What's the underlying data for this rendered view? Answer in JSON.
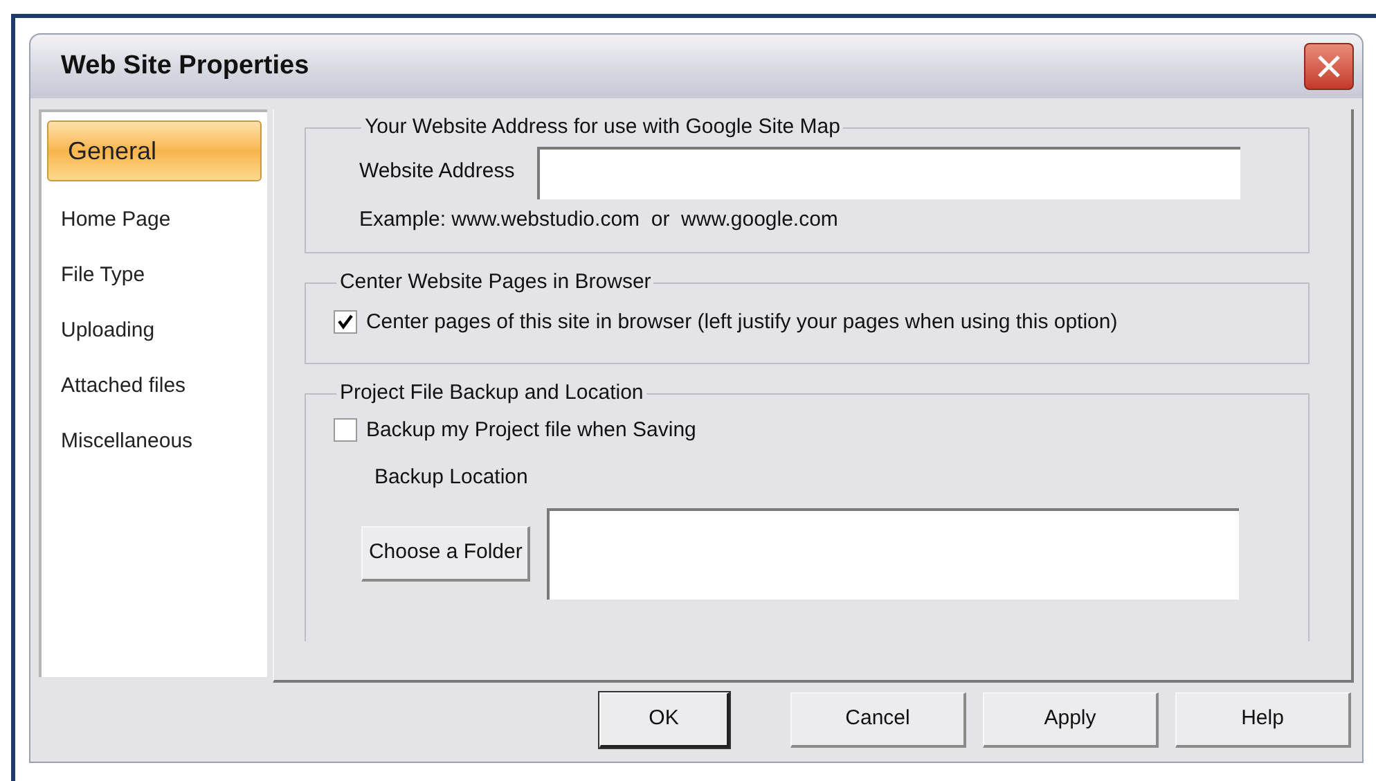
{
  "window": {
    "title": "Web Site Properties"
  },
  "sidebar": {
    "items": [
      {
        "label": "General",
        "selected": true
      },
      {
        "label": "Home Page",
        "selected": false
      },
      {
        "label": "File Type",
        "selected": false
      },
      {
        "label": "Uploading",
        "selected": false
      },
      {
        "label": "Attached files",
        "selected": false
      },
      {
        "label": "Miscellaneous",
        "selected": false
      }
    ]
  },
  "address_group": {
    "legend": "Your Website Address for use with Google Site Map",
    "field_label": "Website Address",
    "example": "Example: www.webstudio.com  or  www.google.com"
  },
  "center_group": {
    "legend": "Center Website Pages in Browser",
    "checkbox": {
      "label": "Center pages of this site in browser (left justify your pages when using this option)",
      "checked": true
    }
  },
  "backup_group": {
    "legend": "Project File Backup and Location",
    "checkbox": {
      "label": "Backup my Project file when Saving",
      "checked": false
    },
    "location_label": "Backup Location",
    "choose_button": "Choose a Folder"
  },
  "buttons": [
    {
      "label": "OK",
      "default": true
    },
    {
      "label": "Cancel",
      "default": false
    },
    {
      "label": "Apply",
      "default": false
    },
    {
      "label": "Help",
      "default": false
    }
  ]
}
